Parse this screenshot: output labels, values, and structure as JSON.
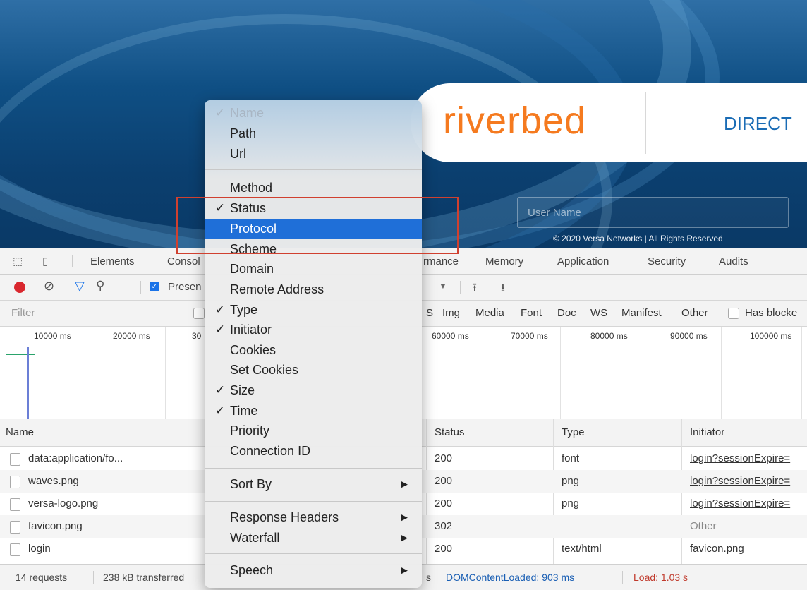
{
  "login_page": {
    "logo": "riverbed",
    "partial_title": "DIRECT",
    "username_placeholder": "User Name",
    "copyright": "© 2020 Versa Networks | All Rights Reserved"
  },
  "devtools": {
    "tabs": [
      "Elements",
      "Consol",
      "rmance",
      "Memory",
      "Application",
      "Security",
      "Audits"
    ],
    "toolbar": {
      "preserve_log": "Presen"
    },
    "filter": {
      "placeholder": "Filter",
      "types": [
        "S",
        "Img",
        "Media",
        "Font",
        "Doc",
        "WS",
        "Manifest",
        "Other"
      ],
      "has_blocked": "Has blocke"
    },
    "timeline_ticks": [
      "10000 ms",
      "20000 ms",
      "30",
      "60000 ms",
      "70000 ms",
      "80000 ms",
      "90000 ms",
      "100000 ms"
    ],
    "columns": [
      "Name",
      "Status",
      "Type",
      "Initiator"
    ],
    "rows": [
      {
        "name": "data:application/fo...",
        "status": "200",
        "type": "font",
        "initiator": "login?sessionExpire="
      },
      {
        "name": "waves.png",
        "status": "200",
        "type": "png",
        "initiator": "login?sessionExpire="
      },
      {
        "name": "versa-logo.png",
        "status": "200",
        "type": "png",
        "initiator": "login?sessionExpire="
      },
      {
        "name": "favicon.png",
        "status": "302",
        "type": "",
        "initiator": "Other"
      },
      {
        "name": "login",
        "status": "200",
        "type": "text/html",
        "initiator": "favicon.png"
      }
    ],
    "statusbar": {
      "requests": "14 requests",
      "transferred": "238 kB transferred",
      "dcl": "DOMContentLoaded: 903 ms",
      "load": "Load: 1.03 s",
      "partial": "s"
    }
  },
  "context_menu": {
    "items_group1": [
      {
        "label": "Name",
        "checked": true
      },
      {
        "label": "Path",
        "checked": false
      },
      {
        "label": "Url",
        "checked": false
      }
    ],
    "items_group2": [
      {
        "label": "Method",
        "checked": false
      },
      {
        "label": "Status",
        "checked": true
      },
      {
        "label": "Protocol",
        "checked": false
      },
      {
        "label": "Scheme",
        "checked": false
      },
      {
        "label": "Domain",
        "checked": false
      },
      {
        "label": "Remote Address",
        "checked": false
      },
      {
        "label": "Type",
        "checked": true
      },
      {
        "label": "Initiator",
        "checked": true
      },
      {
        "label": "Cookies",
        "checked": false
      },
      {
        "label": "Set Cookies",
        "checked": false
      },
      {
        "label": "Size",
        "checked": true
      },
      {
        "label": "Time",
        "checked": true
      },
      {
        "label": "Priority",
        "checked": false
      },
      {
        "label": "Connection ID",
        "checked": false
      }
    ],
    "sort_by": "Sort By",
    "response_headers": "Response Headers",
    "waterfall": "Waterfall",
    "speech": "Speech",
    "check_mark": "✓",
    "submenu_arrow": "▶"
  },
  "colors": {
    "accent_selection": "#1f6fd8",
    "highlight_box": "#d0402f",
    "logo_orange": "#f57a1f",
    "load_red": "#c0392b",
    "dcl_blue": "#1a5fb4"
  }
}
